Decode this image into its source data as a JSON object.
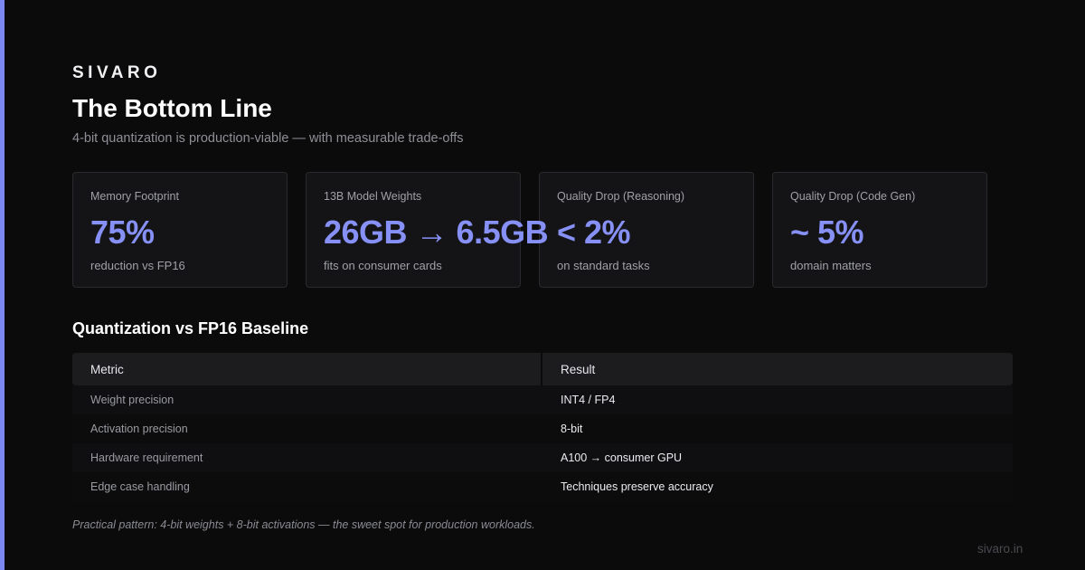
{
  "brand": "SIVARO",
  "title": "The Bottom Line",
  "subtitle": "4-bit quantization is production-viable — with measurable trade-offs",
  "colors": {
    "accent": "#7c87f2",
    "value": "#8690f5",
    "background": "#0b0b0c"
  },
  "cards": [
    {
      "label": "Memory Footprint",
      "value": "75%",
      "note": "reduction vs FP16"
    },
    {
      "label": "13B Model Weights",
      "value": "26GB → 6.5GB",
      "note": "fits on consumer cards"
    },
    {
      "label": "Quality Drop (Reasoning)",
      "value": "< 2%",
      "note": "on standard tasks"
    },
    {
      "label": "Quality Drop (Code Gen)",
      "value": "~ 5%",
      "note": "domain matters"
    }
  ],
  "table": {
    "title": "Quantization vs FP16 Baseline",
    "headers": [
      "Metric",
      "Result"
    ],
    "rows": [
      [
        "Weight precision",
        "INT4 / FP4"
      ],
      [
        "Activation precision",
        "8-bit"
      ],
      [
        "Hardware requirement",
        "A100 → consumer GPU"
      ],
      [
        "Edge case handling",
        "Techniques preserve accuracy"
      ]
    ]
  },
  "footnote": "Practical pattern: 4-bit weights + 8-bit activations — the sweet spot for production workloads.",
  "site": "sivaro.in"
}
